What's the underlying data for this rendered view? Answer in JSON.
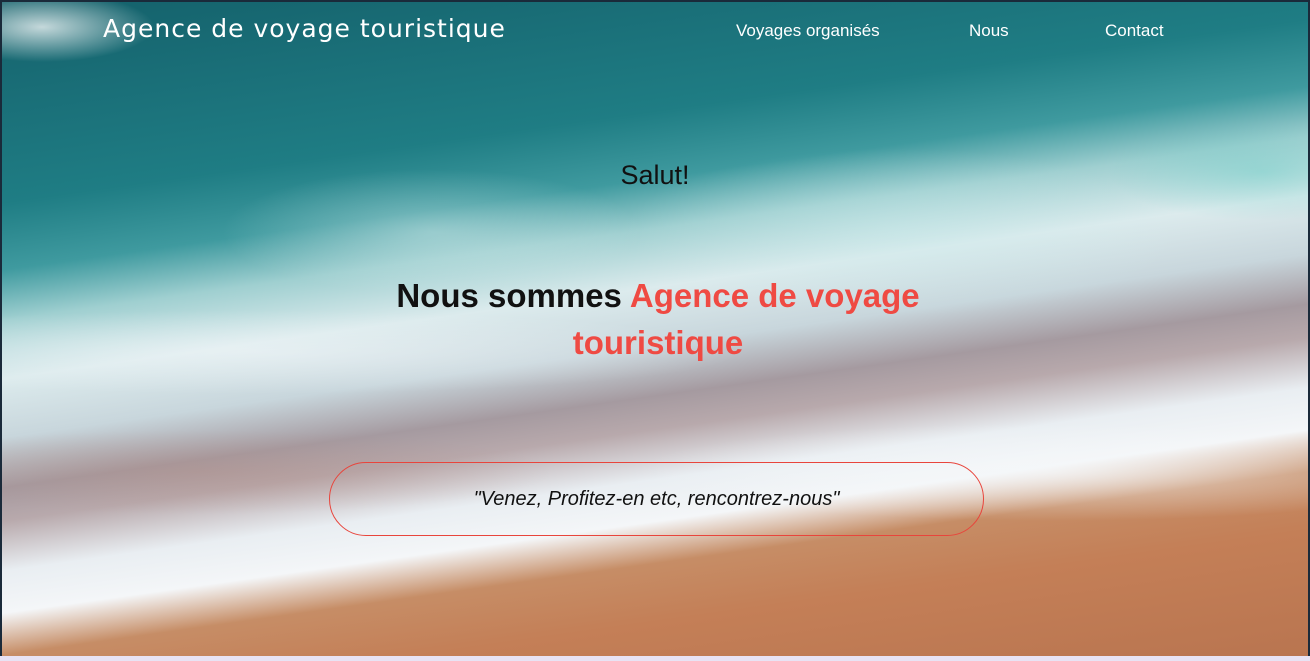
{
  "header": {
    "brand": "Agence de voyage touristique",
    "nav": [
      {
        "label": "Voyages organisés"
      },
      {
        "label": "Nous"
      },
      {
        "label": "Contact"
      }
    ]
  },
  "hero": {
    "greeting": "Salut!",
    "headline_prefix": "Nous sommes",
    "headline_accent": "Agence de voyage touristique",
    "quote": "\"Venez, Profitez-en etc, rencontrez-nous\""
  },
  "colors": {
    "accent": "#ef4a43",
    "text_light": "#ffffff",
    "text_dark": "#111111"
  }
}
